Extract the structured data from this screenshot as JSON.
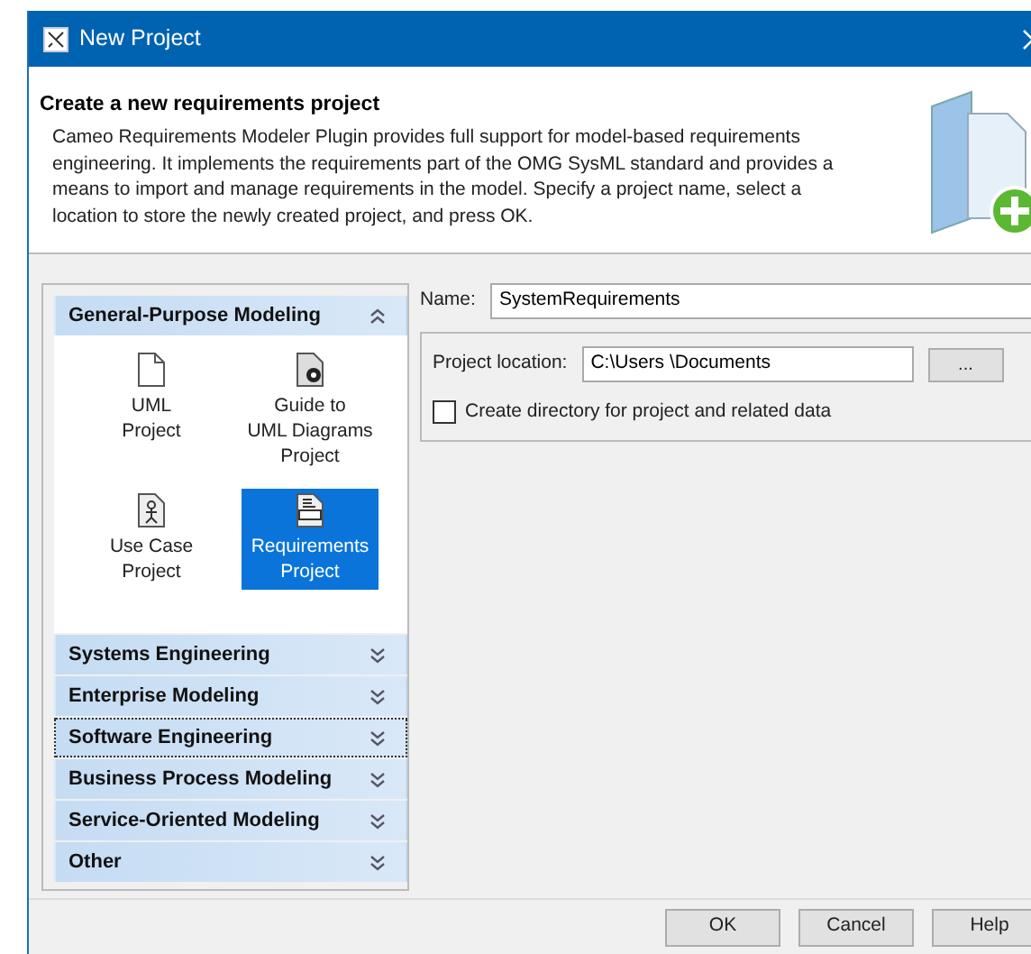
{
  "window": {
    "title": "New Project"
  },
  "header": {
    "title": "Create a new requirements project",
    "description": "Cameo Requirements Modeler Plugin provides full support for model-based requirements engineering. It implements the requirements part of the OMG SysML standard and provides a means to import and manage requirements in the model. Specify a project name, select a location to store the newly created project, and press OK."
  },
  "categories": [
    {
      "label": "General-Purpose Modeling",
      "expanded": true,
      "focused": false,
      "items": [
        {
          "kind": "document",
          "label": "UML\nProject",
          "selected": false
        },
        {
          "kind": "guide",
          "label": "Guide to\nUML Diagrams\nProject",
          "selected": false
        },
        {
          "kind": "usecase",
          "label": "Use Case\nProject",
          "selected": false
        },
        {
          "kind": "requirements",
          "label": "Requirements\nProject",
          "selected": true
        }
      ]
    },
    {
      "label": "Systems Engineering",
      "expanded": false,
      "focused": false
    },
    {
      "label": "Enterprise Modeling",
      "expanded": false,
      "focused": false
    },
    {
      "label": "Software Engineering",
      "expanded": false,
      "focused": true
    },
    {
      "label": "Business Process Modeling",
      "expanded": false,
      "focused": false
    },
    {
      "label": "Service-Oriented Modeling",
      "expanded": false,
      "focused": false
    },
    {
      "label": "Other",
      "expanded": false,
      "focused": false
    }
  ],
  "form": {
    "name_label": "Name:",
    "name_value": "SystemRequirements",
    "location_label": "Project location:",
    "location_value": "C:\\Users \\Documents",
    "browse": "...",
    "checkbox": {
      "label": "Create directory for project and related data",
      "checked": false
    }
  },
  "buttons": [
    "OK",
    "Cancel",
    "Help"
  ]
}
